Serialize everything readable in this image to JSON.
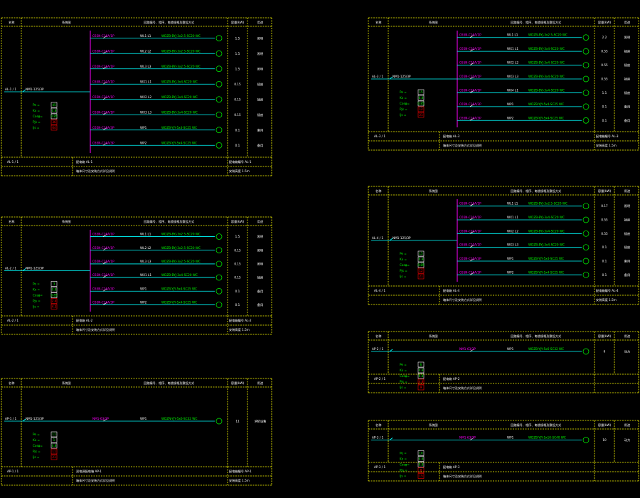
{
  "headers": {
    "col1": "名称",
    "col2": "系统图",
    "col3": "回路编号、相序、电缆规格及敷设方式",
    "col4": "容量(kW)",
    "col5": "用途"
  },
  "colors": {
    "frame": "#ffff00",
    "bus": "#00ffff",
    "circuit": "#00ff00",
    "feeder": "#ff00ff",
    "terminal": "#ffffff",
    "alarm": "#ff0000"
  },
  "panels": [
    {
      "incoming": "AL-1 / 1",
      "breaker": "NM1-125/3P",
      "footer": [
        "配电箱 AL-1",
        "箱体尺寸及安装方式详见说明"
      ],
      "footer_right": [
        "配电箱编号 AL-1",
        "安装高度 1.5m"
      ],
      "meter": [
        "Pe =",
        "Kx =",
        "Cosφ=",
        "Pjs =",
        "Ijs ="
      ],
      "meter_vals": [
        "45",
        "0.8",
        "0.85",
        "36",
        "64"
      ],
      "circuits": [
        {
          "label": "C65N-C16A/1P",
          "code": "WL1  L1",
          "cable": "WDZB-BYJ-3x2.5-SC20 WC",
          "kw": "1.5",
          "use": "照明"
        },
        {
          "label": "C65N-C16A/1P",
          "code": "WL2  L2",
          "cable": "WDZB-BYJ-3x2.5-SC20 WC",
          "kw": "1.5",
          "use": "照明"
        },
        {
          "label": "C65N-C16A/1P",
          "code": "WL3  L3",
          "cable": "WDZB-BYJ-3x2.5-SC20 WC",
          "kw": "1.5",
          "use": "照明"
        },
        {
          "label": "C65N-C20A/1P",
          "code": "WX1  L1",
          "cable": "WDZB-BYJ-3x4-SC20 WC",
          "kw": "0.15",
          "use": "插座"
        },
        {
          "label": "C65N-C20A/1P",
          "code": "WX2  L2",
          "cable": "WDZB-BYJ-3x4-SC20 WC",
          "kw": "0.15",
          "use": "插座"
        },
        {
          "label": "C65N-C20A/1P",
          "code": "WX3  L3",
          "cable": "WDZB-BYJ-3x4-SC20 WC",
          "kw": "0.15",
          "use": "插座"
        },
        {
          "label": "C65N-C16A/3P",
          "code": "WP1",
          "cable": "WDZB-YJY-5x4-SC25 WC",
          "kw": "0.1",
          "use": "备用"
        },
        {
          "label": "C65N-C16A/3P",
          "code": "WP2",
          "cable": "WDZB-YJY-5x4-SC25 WC",
          "kw": "0.1",
          "use": "备用"
        }
      ]
    },
    {
      "incoming": "AL-2 / 1",
      "breaker": "NM1-125/3P",
      "footer": [
        "配电箱 AL-2",
        "箱体尺寸及安装方式详见说明"
      ],
      "footer_right": [
        "配电箱编号 AL-2",
        "安装高度 1.5m"
      ],
      "meter": [
        "Pe =",
        "Kx =",
        "Cosφ=",
        "Pjs =",
        "Ijs ="
      ],
      "meter_vals": [
        "3",
        "0.8",
        "0.85",
        "2.4",
        "4.3"
      ],
      "circuits": [
        {
          "label": "C65N-C16A/1P",
          "code": "WL1  L1",
          "cable": "WDZB-BYJ-3x2.5-SC20 WC",
          "kw": "1.5",
          "use": "照明"
        },
        {
          "label": "C65N-C16A/1P",
          "code": "WL2  L2",
          "cable": "WDZB-BYJ-3x2.5-SC20 WC",
          "kw": "0.15",
          "use": "照明"
        },
        {
          "label": "C65N-C16A/1P",
          "code": "WL3  L3",
          "cable": "WDZB-BYJ-3x2.5-SC20 WC",
          "kw": "0.15",
          "use": "照明"
        },
        {
          "label": "C65N-C20A/1P",
          "code": "WX1  L1",
          "cable": "WDZB-BYJ-3x4-SC20 WC",
          "kw": "0.15",
          "use": "插座"
        },
        {
          "label": "C65N-C16A/3P",
          "code": "WP1",
          "cable": "WDZB-YJY-5x4-SC25 WC",
          "kw": "0.1",
          "use": "备用"
        },
        {
          "label": "C65N-C16A/3P",
          "code": "WP2",
          "cable": "WDZB-YJY-5x4-SC25 WC",
          "kw": "0.1",
          "use": "备用"
        }
      ]
    },
    {
      "incoming": "AP-1 / 1",
      "breaker": "NM1-125/3P",
      "footer": [
        "双电源配电箱 AP-1",
        "箱体尺寸及安装方式详见说明"
      ],
      "footer_right": [
        "配电箱编号 AP-1",
        "安装高度 1.5m"
      ],
      "meter": [
        "Pe =",
        "Kx =",
        "Cosφ=",
        "Pjs =",
        "Ijs ="
      ],
      "meter_vals": [
        "11",
        "1",
        "0.8",
        "11",
        "21"
      ],
      "circuits": [
        {
          "label": "NM1-63/3P",
          "code": "WP1",
          "cable": "WDZN-YJY-5x6-SC32 WC",
          "kw": "11",
          "use": "消防设备"
        }
      ]
    },
    {
      "incoming": "AL-3 / 1",
      "breaker": "NM1-125/3P",
      "footer": [
        "配电箱 AL-3",
        "箱体尺寸及安装方式详见说明"
      ],
      "footer_right": [
        "配电箱编号 AL-3",
        "安装高度 1.5m"
      ],
      "meter": [
        "Pe =",
        "Kx =",
        "Cosφ=",
        "Pjs =",
        "Ijs ="
      ],
      "meter_vals": [
        "15",
        "0.8",
        "0.85",
        "12",
        "21"
      ],
      "circuits": [
        {
          "label": "C65N-C16A/1P",
          "code": "WL1  L1",
          "cable": "WDZB-BYJ-3x2.5-SC20 WC",
          "kw": "2.2",
          "use": "照明"
        },
        {
          "label": "C65N-C20A/1P",
          "code": "WX1  L1",
          "cable": "WDZB-BYJ-3x4-SC20 WC",
          "kw": "0.55",
          "use": "插座"
        },
        {
          "label": "C65N-C20A/1P",
          "code": "WX2  L2",
          "cable": "WDZB-BYJ-3x4-SC20 WC",
          "kw": "0.55",
          "use": "插座"
        },
        {
          "label": "C65N-C20A/1P",
          "code": "WX3  L3",
          "cable": "WDZB-BYJ-3x4-SC20 WC",
          "kw": "0.55",
          "use": "插座"
        },
        {
          "label": "C65N-C20A/1P",
          "code": "WX4  L1",
          "cable": "WDZB-BYJ-3x4-SC20 WC",
          "kw": "1.1",
          "use": "插座"
        },
        {
          "label": "C65N-C16A/3P",
          "code": "WP1",
          "cable": "WDZB-YJY-5x4-SC25 WC",
          "kw": "0.1",
          "use": "备用"
        },
        {
          "label": "C65N-C16A/3P",
          "code": "WP2",
          "cable": "WDZB-YJY-5x4-SC25 WC",
          "kw": "0.1",
          "use": "备用"
        }
      ]
    },
    {
      "incoming": "AL-4 / 1",
      "breaker": "NM1-125/3P",
      "footer": [
        "配电箱 AL-4",
        "箱体尺寸及安装方式详见说明"
      ],
      "footer_right": [
        "配电箱编号 AL-4",
        "安装高度 1.5m"
      ],
      "meter": [
        "Pe =",
        "Kx =",
        "Cosφ=",
        "Pjs =",
        "Ijs ="
      ],
      "meter_vals": [
        "15",
        "0.8",
        "0.85",
        "12",
        "21"
      ],
      "circuits": [
        {
          "label": "C65N-C16A/1P",
          "code": "WL1  L1",
          "cable": "WDZB-BYJ-3x2.5-SC20 WC",
          "kw": "0.17",
          "use": "照明"
        },
        {
          "label": "C65N-C20A/1P",
          "code": "WX1  L1",
          "cable": "WDZB-BYJ-3x4-SC20 WC",
          "kw": "0.55",
          "use": "插座"
        },
        {
          "label": "C65N-C20A/1P",
          "code": "WX2  L2",
          "cable": "WDZB-BYJ-3x4-SC20 WC",
          "kw": "0.55",
          "use": "插座"
        },
        {
          "label": "C65N-C20A/1P",
          "code": "WX3  L3",
          "cable": "WDZB-BYJ-3x4-SC20 WC",
          "kw": "0.1",
          "use": "插座"
        },
        {
          "label": "C65N-C16A/3P",
          "code": "WP1",
          "cable": "WDZB-YJY-5x4-SC25 WC",
          "kw": "0.1",
          "use": "备用"
        },
        {
          "label": "C65N-C16A/3P",
          "code": "WP2",
          "cable": "WDZB-YJY-5x4-SC25 WC",
          "kw": "0.1",
          "use": "备用"
        }
      ]
    },
    {
      "incoming": "AP-2 / 1",
      "breaker": "",
      "footer": [
        "配电箱 AP-2",
        "箱体尺寸及安装方式详见说明"
      ],
      "footer_right": [
        "",
        ""
      ],
      "meter": [
        "Pe =",
        "Kx =",
        "Cosφ=",
        "Pjs =",
        "Ijs ="
      ],
      "meter_vals": [
        "6",
        "0.8",
        "0.8",
        "4.8",
        "9"
      ],
      "circuits": [
        {
          "label": "NM1-63/3P",
          "code": "WP1",
          "cable": "WDZB-YJY-5x6-SC32 WC",
          "kw": "6",
          "use": "动力"
        }
      ]
    },
    {
      "incoming": "AP-3 / 1",
      "breaker": "",
      "footer": [
        "配电箱 AP-3",
        "箱体尺寸及安装方式详见说明"
      ],
      "footer_right": [
        "",
        ""
      ],
      "meter": [
        "Pe =",
        "Kx =",
        "Cosφ=",
        "Pjs =",
        "Ijs ="
      ],
      "meter_vals": [
        "10",
        "0.8",
        "0.8",
        "8",
        "15"
      ],
      "circuits": [
        {
          "label": "NM1-63/3P",
          "code": "WP1",
          "cable": "WDZB-YJY-5x10-SC40 WC",
          "kw": "10",
          "use": "动力"
        }
      ]
    }
  ]
}
